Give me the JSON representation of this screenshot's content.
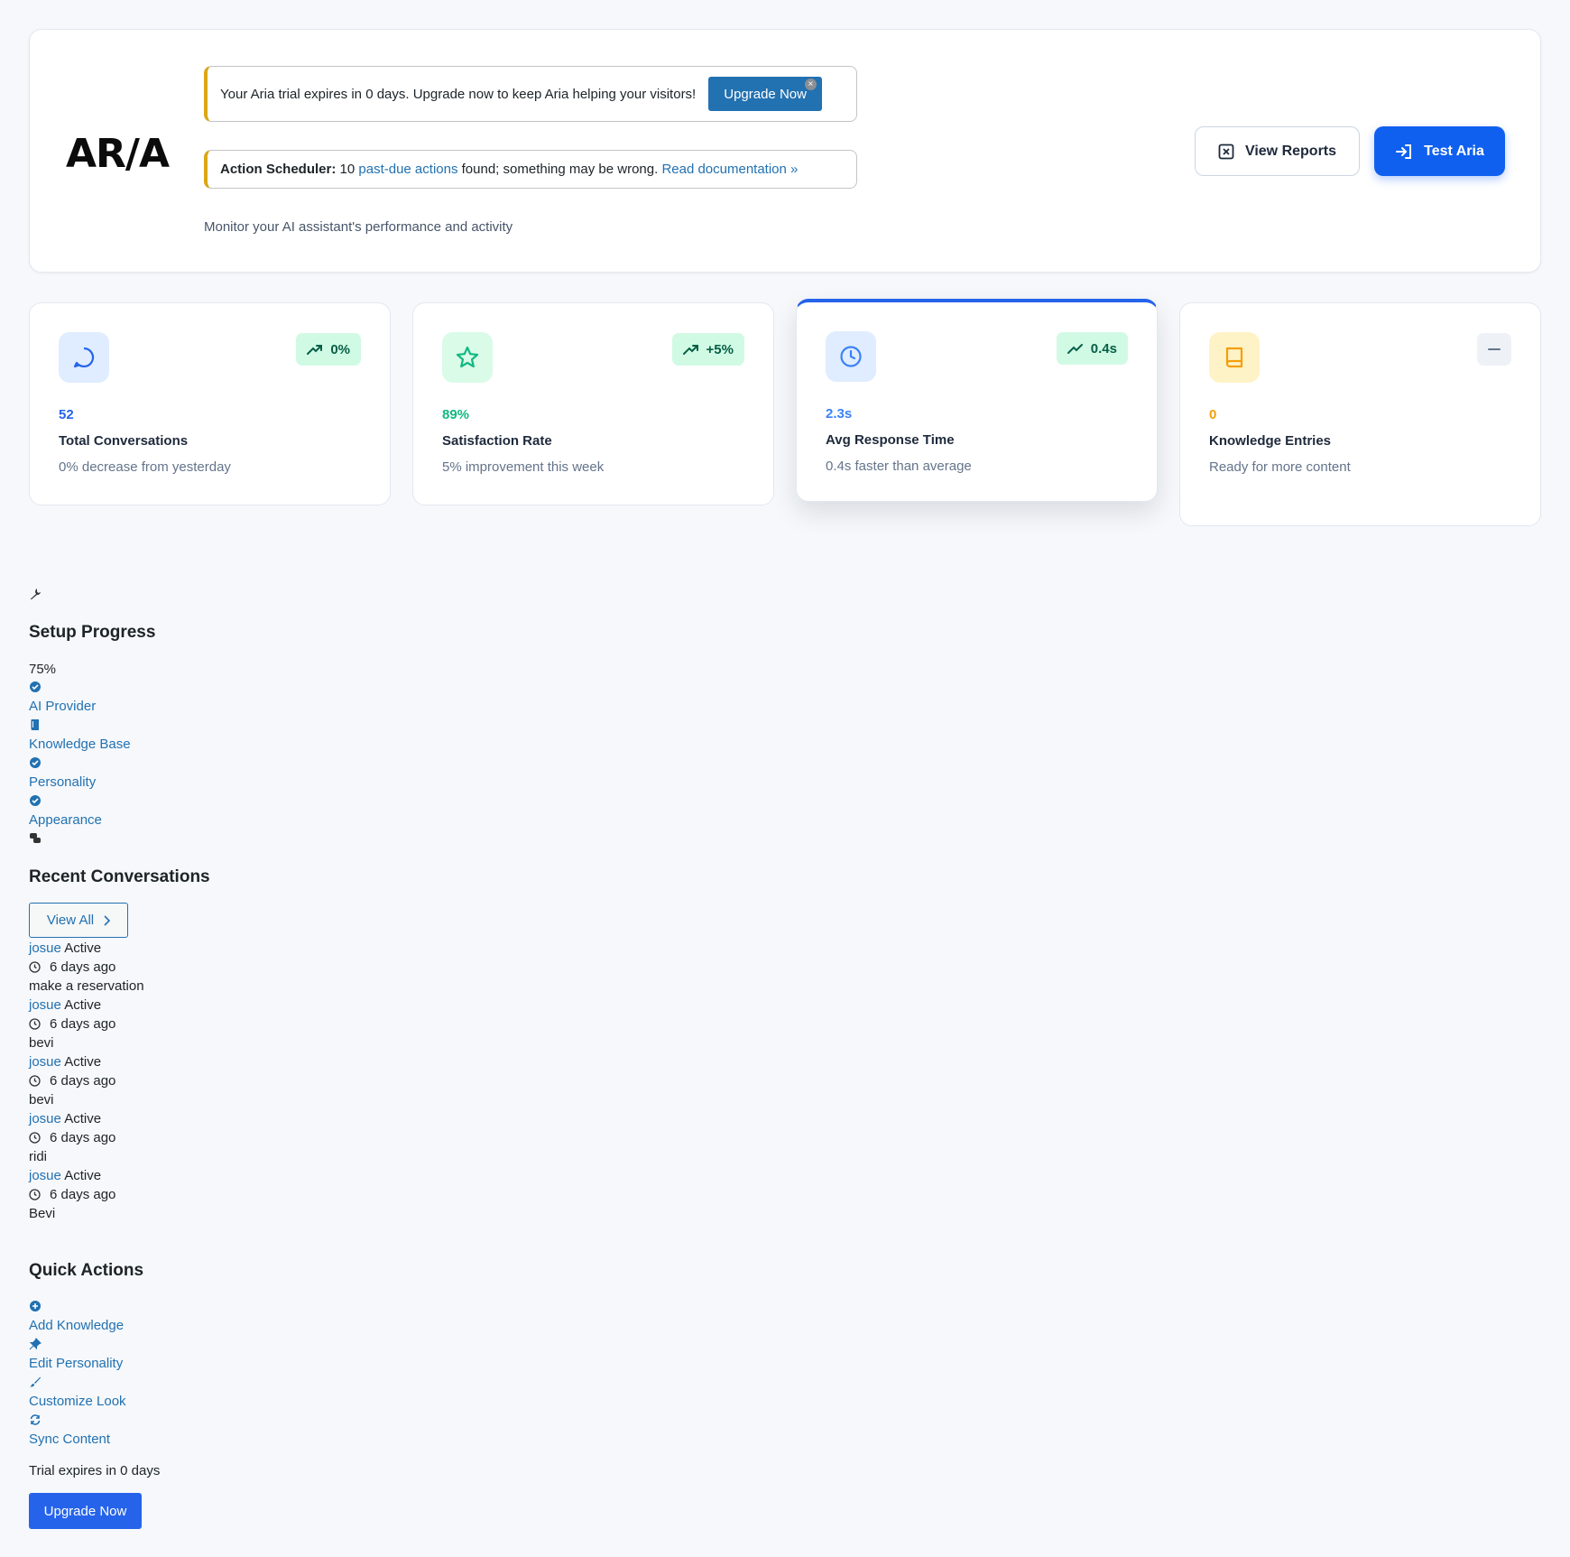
{
  "header": {
    "logo": "AR/A",
    "trial_notice": "Your Aria trial expires in 0 days. Upgrade now to keep Aria helping your visitors!",
    "trial_button": "Upgrade Now",
    "scheduler_label": "Action Scheduler:",
    "scheduler_text_1": "10",
    "scheduler_link": "past-due actions",
    "scheduler_text_2": "found; something may be wrong.",
    "scheduler_doc_link": "Read documentation »",
    "subtitle": "Monitor your AI assistant's performance and activity",
    "view_reports": "View Reports",
    "test_aria": "Test Aria"
  },
  "stats": [
    {
      "value": "52",
      "label": "Total Conversations",
      "desc": "0% decrease from yesterday",
      "trend": "0%",
      "value_color": "#2563eb",
      "icon": "chat-icon"
    },
    {
      "value": "89%",
      "label": "Satisfaction Rate",
      "desc": "5% improvement this week",
      "trend": "+5%",
      "value_color": "#10b981",
      "icon": "star-icon"
    },
    {
      "value": "2.3s",
      "label": "Avg Response Time",
      "desc": "0.4s faster than average",
      "trend": "0.4s",
      "value_color": "#3b82f6",
      "icon": "clock-icon"
    },
    {
      "value": "0",
      "label": "Knowledge Entries",
      "desc": "Ready for more content",
      "trend": "—",
      "value_color": "#f59e0b",
      "icon": "book-icon"
    }
  ],
  "setup": {
    "title": "Setup Progress",
    "percent": "75%",
    "steps": [
      {
        "label": "AI Provider",
        "icon": "check-circle-icon"
      },
      {
        "label": "Knowledge Base",
        "icon": "book-icon"
      },
      {
        "label": "Personality",
        "icon": "check-circle-icon"
      },
      {
        "label": "Appearance",
        "icon": "check-circle-icon"
      }
    ]
  },
  "recent": {
    "title": "Recent Conversations",
    "view_all": "View All",
    "items": [
      {
        "user": "josue",
        "status": "Active",
        "time": "6 days ago",
        "message": "make a reservation"
      },
      {
        "user": "josue",
        "status": "Active",
        "time": "6 days ago",
        "message": "bevi"
      },
      {
        "user": "josue",
        "status": "Active",
        "time": "6 days ago",
        "message": "bevi"
      },
      {
        "user": "josue",
        "status": "Active",
        "time": "6 days ago",
        "message": "ridi"
      },
      {
        "user": "josue",
        "status": "Active",
        "time": "6 days ago",
        "message": "Bevi"
      }
    ]
  },
  "quick": {
    "title": "Quick Actions",
    "actions": [
      {
        "label": "Add Knowledge",
        "icon": "plus-circle-icon"
      },
      {
        "label": "Edit Personality",
        "icon": "pin-icon"
      },
      {
        "label": "Customize Look",
        "icon": "brush-icon"
      },
      {
        "label": "Sync Content",
        "icon": "sync-icon"
      }
    ]
  },
  "footer": {
    "trial_text": "Trial expires in 0 days",
    "upgrade_button": "Upgrade Now"
  }
}
